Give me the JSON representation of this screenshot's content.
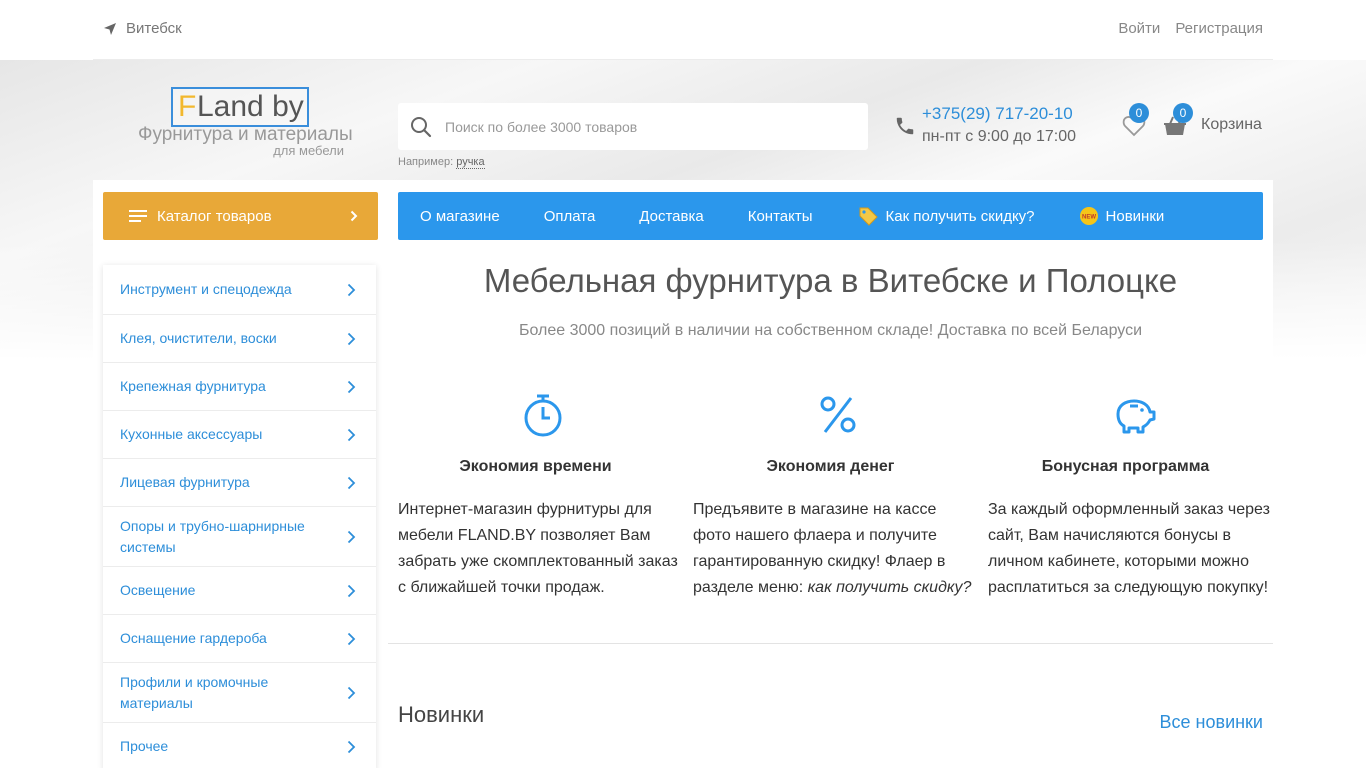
{
  "topbar": {
    "city": "Витебск",
    "login": "Войти",
    "register": "Регистрация"
  },
  "logo": {
    "letter": "F",
    "rest": "Land by",
    "subtitle": "Фурнитура и материалы",
    "subtitle2": "для мебели"
  },
  "search": {
    "placeholder": "Поиск по более 3000 товаров",
    "example_prefix": "Например:",
    "example_link": "ручка"
  },
  "contacts": {
    "phone": "+375(29) 717-20-10",
    "hours": "пн-пт с 9:00 до 17:00"
  },
  "header": {
    "fav_count": "0",
    "cart_count": "0",
    "cart_label": "Корзина"
  },
  "catalog": {
    "button_label": "Каталог товаров",
    "items": [
      {
        "label": "Инструмент и спецодежда"
      },
      {
        "label": "Клея, очистители, воски"
      },
      {
        "label": "Крепежная фурнитура"
      },
      {
        "label": "Кухонные аксессуары"
      },
      {
        "label": "Лицевая фурнитура"
      },
      {
        "label": "Опоры и трубно-шарнирные системы"
      },
      {
        "label": "Освещение"
      },
      {
        "label": "Оснащение гардероба"
      },
      {
        "label": "Профили и кромочные материалы"
      },
      {
        "label": "Прочее"
      }
    ]
  },
  "nav": {
    "items": [
      {
        "label": "О магазине"
      },
      {
        "label": "Оплата"
      },
      {
        "label": "Доставка"
      },
      {
        "label": "Контакты"
      },
      {
        "label": "Как получить скидку?"
      },
      {
        "label": "Новинки"
      }
    ]
  },
  "main": {
    "title": "Мебельная фурнитура в Витебске и Полоцке",
    "subtitle": "Более 3000 позиций в наличии на собственном складе! Доставка по всей Беларуси",
    "features": [
      {
        "title": "Экономия времени",
        "text": "Интернет-магазин фурнитуры для мебели FLAND.BY позволяет Вам забрать уже скомплектованный заказ с ближайшей точки продаж."
      },
      {
        "title": "Экономия денег",
        "text": "Предъявите в магазине на кассе фото нашего флаера и получите гарантированную скидку! Флаер в разделе меню: ",
        "link": "как получить скидку?"
      },
      {
        "title": "Бонусная программа",
        "text": "За каждый оформленный заказ через сайт, Вам начисляются бонусы в личном кабинете, которыми можно расплатиться за следующую покупку!"
      }
    ],
    "new_title": "Новинки",
    "new_all": "Все новинки"
  },
  "colors": {
    "accent_blue": "#2b97ec",
    "catalog_orange": "#e8a838",
    "link_blue": "#2d8ed9"
  }
}
